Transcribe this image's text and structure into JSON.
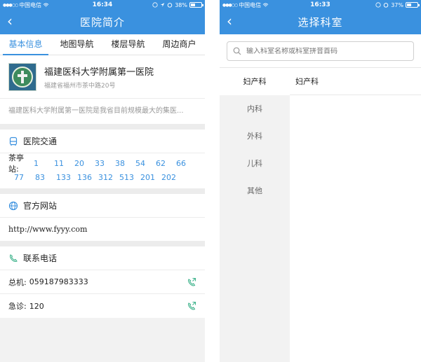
{
  "left": {
    "status": {
      "carrier": "中国电信",
      "time": "16:34",
      "battery": "38%",
      "battery_level": 0.38
    },
    "nav": {
      "back": "‹",
      "title": "医院简介"
    },
    "tabs": [
      {
        "label": "基本信息",
        "active": true
      },
      {
        "label": "地图导航"
      },
      {
        "label": "楼层导航"
      },
      {
        "label": "周边商户"
      }
    ],
    "hospital": {
      "name": "福建医科大学附属第一医院",
      "address": "福建省福州市茶中路20号",
      "description": "福建医科大学附属第一医院是我省目前规模最大的集医..."
    },
    "transport": {
      "heading": "医院交通",
      "stop_label": "茶亭站:",
      "row1": [
        "1",
        "11",
        "20",
        "33",
        "38",
        "54",
        "62",
        "66"
      ],
      "row2": [
        "77",
        "83",
        "133",
        "136",
        "312",
        "513",
        "201",
        "202"
      ]
    },
    "website": {
      "heading": "官方网站",
      "url": "http://www.fyyy.com"
    },
    "contact": {
      "heading": "联系电话",
      "phones": [
        {
          "label": "总机:",
          "number": "059187983333"
        },
        {
          "label": "急诊:",
          "number": "120"
        }
      ]
    },
    "colors": {
      "accent": "#3a91df",
      "bus_number": "#3a91df",
      "phone_icon": "#3fb38c"
    }
  },
  "right": {
    "status": {
      "carrier": "中国电信",
      "time": "16:33",
      "battery": "37%",
      "battery_level": 0.37
    },
    "nav": {
      "back": "‹",
      "title": "选择科室"
    },
    "search": {
      "placeholder": "输入科室名称或科室拼音首码"
    },
    "departments": [
      {
        "label": "妇产科",
        "active": true
      },
      {
        "label": "内科"
      },
      {
        "label": "外科"
      },
      {
        "label": "儿科"
      },
      {
        "label": "其他"
      }
    ],
    "sub_departments": [
      "妇产科"
    ]
  }
}
